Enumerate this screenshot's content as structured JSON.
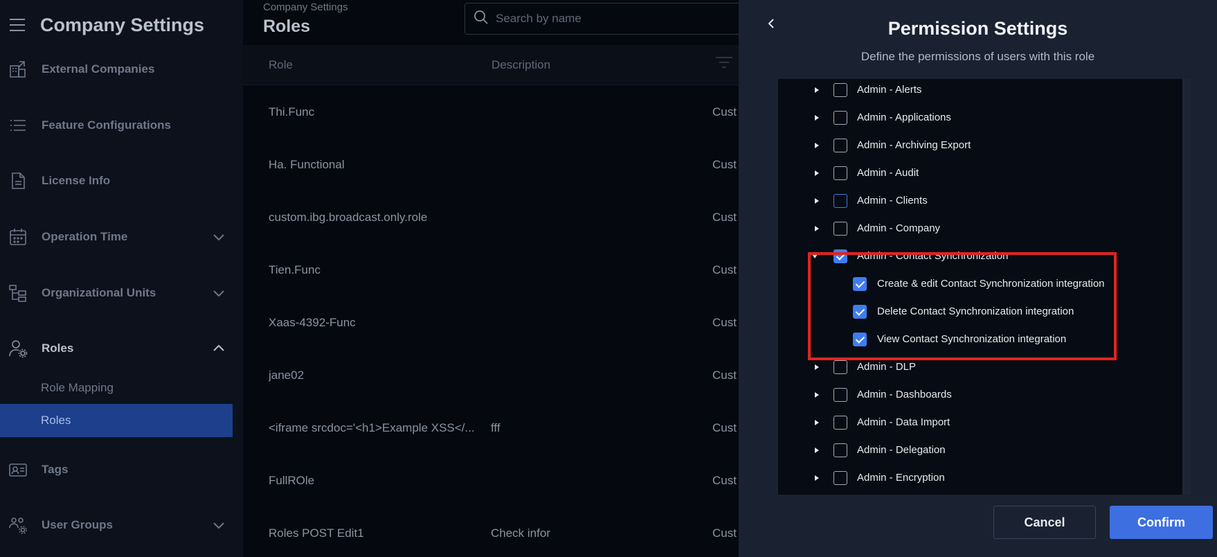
{
  "sidebar": {
    "title": "Company Settings",
    "items": [
      {
        "label": "External Companies",
        "icon": "building-arrow-icon"
      },
      {
        "label": "Feature Configurations",
        "icon": "list-icon"
      },
      {
        "label": "License Info",
        "icon": "document-icon"
      },
      {
        "label": "Operation Time",
        "icon": "calendar-icon",
        "expandable": true
      },
      {
        "label": "Organizational Units",
        "icon": "org-tree-icon",
        "expandable": true
      },
      {
        "label": "Roles",
        "icon": "user-gear-icon",
        "expanded": true
      },
      {
        "label": "Tags",
        "icon": "id-card-icon"
      },
      {
        "label": "User Groups",
        "icon": "group-gear-icon",
        "expandable": true
      }
    ],
    "sub_items": [
      {
        "label": "Role Mapping",
        "active": false
      },
      {
        "label": "Roles",
        "active": true
      }
    ]
  },
  "main": {
    "breadcrumb": "Company Settings",
    "title": "Roles",
    "search_placeholder": "Search by name",
    "columns": [
      "Role",
      "Description"
    ],
    "rows": [
      {
        "role": "Thi.Func",
        "description": "",
        "type": "Cust"
      },
      {
        "role": "Ha. Functional",
        "description": "",
        "type": "Cust"
      },
      {
        "role": "custom.ibg.broadcast.only.role",
        "description": "",
        "type": "Cust"
      },
      {
        "role": "Tien.Func",
        "description": "",
        "type": "Cust"
      },
      {
        "role": "Xaas-4392-Func",
        "description": "",
        "type": "Cust"
      },
      {
        "role": "jane02",
        "description": "",
        "type": "Cust"
      },
      {
        "role": "<iframe srcdoc='<h1>Example XSS</...",
        "description": "fff",
        "type": "Cust"
      },
      {
        "role": "FullROle",
        "description": "",
        "type": "Cust"
      },
      {
        "role": "Roles POST Edit1",
        "description": "Check infor",
        "type": "Cust"
      }
    ]
  },
  "dialog": {
    "title": "Permission Settings",
    "subtitle": "Define the permissions of users with this role",
    "permissions": [
      {
        "label": "Admin - Alerts",
        "checked": false
      },
      {
        "label": "Admin - Applications",
        "checked": false
      },
      {
        "label": "Admin - Archiving Export",
        "checked": false
      },
      {
        "label": "Admin - Audit",
        "checked": false
      },
      {
        "label": "Admin - Clients",
        "checked": false,
        "focused": true
      },
      {
        "label": "Admin - Company",
        "checked": false
      },
      {
        "label": "Admin - Contact Synchronization",
        "checked": true,
        "expanded": true
      },
      {
        "label": "Create & edit Contact Synchronization integration",
        "checked": true,
        "child": true
      },
      {
        "label": "Delete Contact Synchronization integration",
        "checked": true,
        "child": true
      },
      {
        "label": "View Contact Synchronization integration",
        "checked": true,
        "child": true
      },
      {
        "label": "Admin - DLP",
        "checked": false
      },
      {
        "label": "Admin - Dashboards",
        "checked": false
      },
      {
        "label": "Admin - Data Import",
        "checked": false
      },
      {
        "label": "Admin - Delegation",
        "checked": false
      },
      {
        "label": "Admin - Encryption",
        "checked": false
      }
    ],
    "cancel_label": "Cancel",
    "confirm_label": "Confirm"
  },
  "colors": {
    "accent": "#3d7df0",
    "highlight": "#e3231f",
    "sidebar_active": "#1d3f8c"
  }
}
